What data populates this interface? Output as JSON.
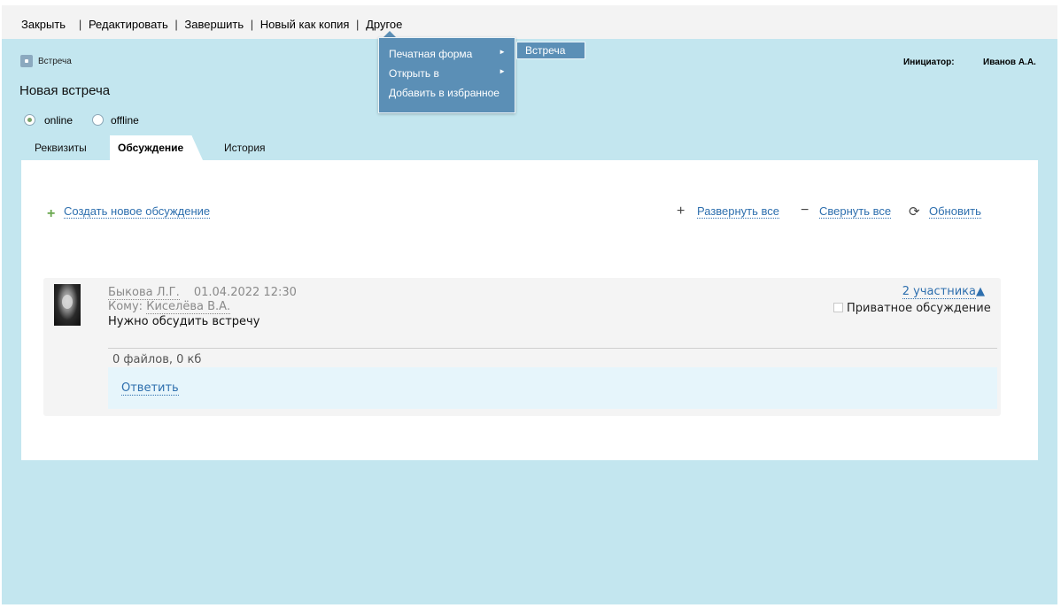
{
  "menu": {
    "close": "Закрыть",
    "edit": "Редактировать",
    "finish": "Завершить",
    "new_copy": "Новый как копия",
    "other": "Другое"
  },
  "dropdown": {
    "items": [
      {
        "label": "Печатная форма",
        "arrow": "►"
      },
      {
        "label": "Открыть в",
        "arrow": "►"
      },
      {
        "label": "Добавить в избранное"
      }
    ],
    "submenu_item": "Встреча"
  },
  "doc": {
    "type": "Встреча",
    "title": "Новая встреча",
    "initiator_label": "Инициатор:",
    "initiator_value": "Иванов А.А."
  },
  "mode": {
    "online": "online",
    "offline": "offline",
    "selected": "online"
  },
  "tabs": [
    {
      "label": "Реквизиты"
    },
    {
      "label": "Обсуждение",
      "active": true
    },
    {
      "label": "История"
    }
  ],
  "toolbar": {
    "create": "Создать новое обсуждение",
    "expand_all": "Развернуть все",
    "collapse_all": "Свернуть все",
    "refresh": "Обновить"
  },
  "discussion": {
    "author": "Быкова Л.Г.",
    "datetime": "01.04.2022 12:30",
    "to_label": "Кому:",
    "to_value": "Киселёва В.А.",
    "message": "Нужно обсудить встречу",
    "participants": "2 участника",
    "participants_arrow": "▲",
    "private_label": "Приватное обсуждение",
    "files": "0 файлов, 0 кб",
    "reply": "Ответить"
  },
  "colors": {
    "background": "#c3e6ef",
    "menu_dropdown": "#5b8fb6",
    "link": "#2e6fae",
    "reply_bar": "#e6f5fb"
  }
}
